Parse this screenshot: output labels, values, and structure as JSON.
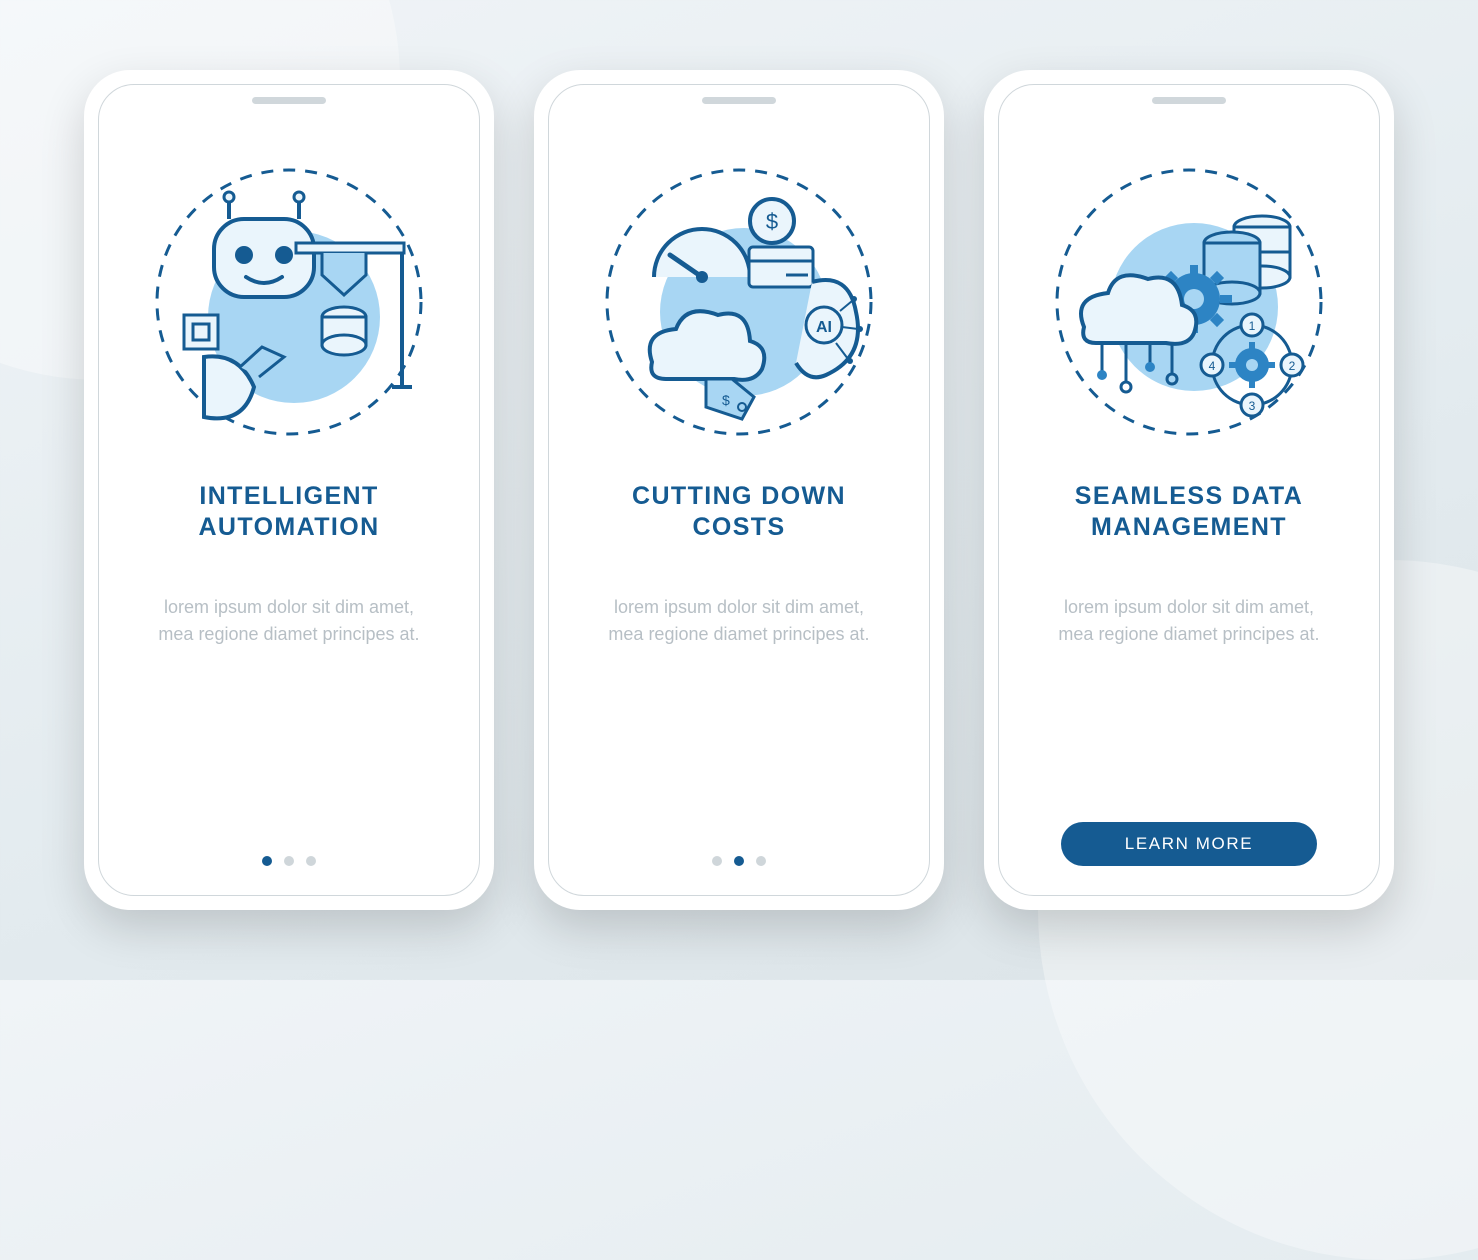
{
  "colors": {
    "primary": "#155b92",
    "light": "#7cc2ee",
    "grey": "#b9c2c9"
  },
  "shared": {
    "placeholder": "lorem ipsum dolor sit dim amet, mea regione diamet principes at."
  },
  "screens": [
    {
      "title": "INTELLIGENT AUTOMATION",
      "activeDot": 0,
      "hasCTA": false
    },
    {
      "title": "CUTTING DOWN COSTS",
      "activeDot": 1,
      "hasCTA": false
    },
    {
      "title": "SEAMLESS DATA MANAGEMENT",
      "activeDot": 2,
      "hasCTA": true
    }
  ],
  "cta": {
    "label": "LEARN MORE"
  }
}
